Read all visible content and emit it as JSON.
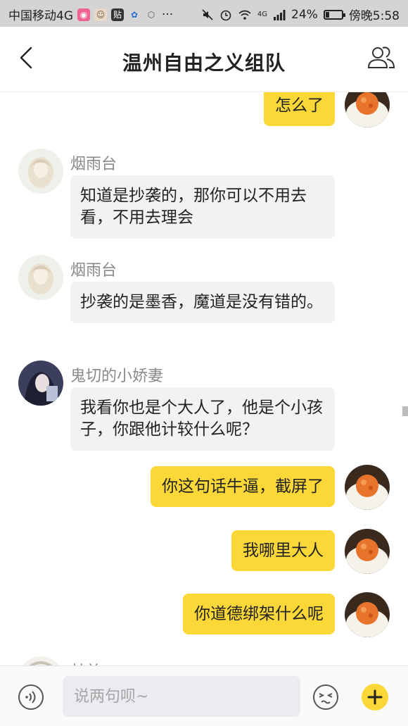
{
  "status_bar": {
    "carrier": "中国移动4G",
    "app_icon_badge": "贴",
    "more": "···",
    "network_type": "4G",
    "battery": "24%",
    "battery_level": 0.24,
    "time": "傍晚5:58"
  },
  "header": {
    "title": "温州自由之义组队"
  },
  "messages": [
    {
      "direction": "out",
      "text": "怎么了"
    },
    {
      "direction": "in",
      "sender": "烟雨台",
      "text": "知道是抄袭的，那你可以不用去看，不用去理会"
    },
    {
      "direction": "in",
      "sender": "烟雨台",
      "text": "抄袭的是墨香，魔道是没有错的。"
    },
    {
      "direction": "in",
      "sender": "鬼切的小娇妻",
      "text": "我看你也是个大人了，他是个小孩子，你跟他计较什么呢？"
    },
    {
      "direction": "out",
      "text": "你这句话牛逼，截屏了"
    },
    {
      "direction": "out",
      "text": "我哪里大人"
    },
    {
      "direction": "out",
      "text": "你道德绑架什么呢"
    },
    {
      "direction": "in",
      "sender": "林美",
      "text": ""
    }
  ],
  "input": {
    "placeholder": "说两句呗~"
  },
  "colors": {
    "outgoing_bubble": "#fbd838",
    "incoming_bubble": "#f4f1f5",
    "plus_button": "#fbd838",
    "status_bar_bg": "#d4d4d4"
  }
}
